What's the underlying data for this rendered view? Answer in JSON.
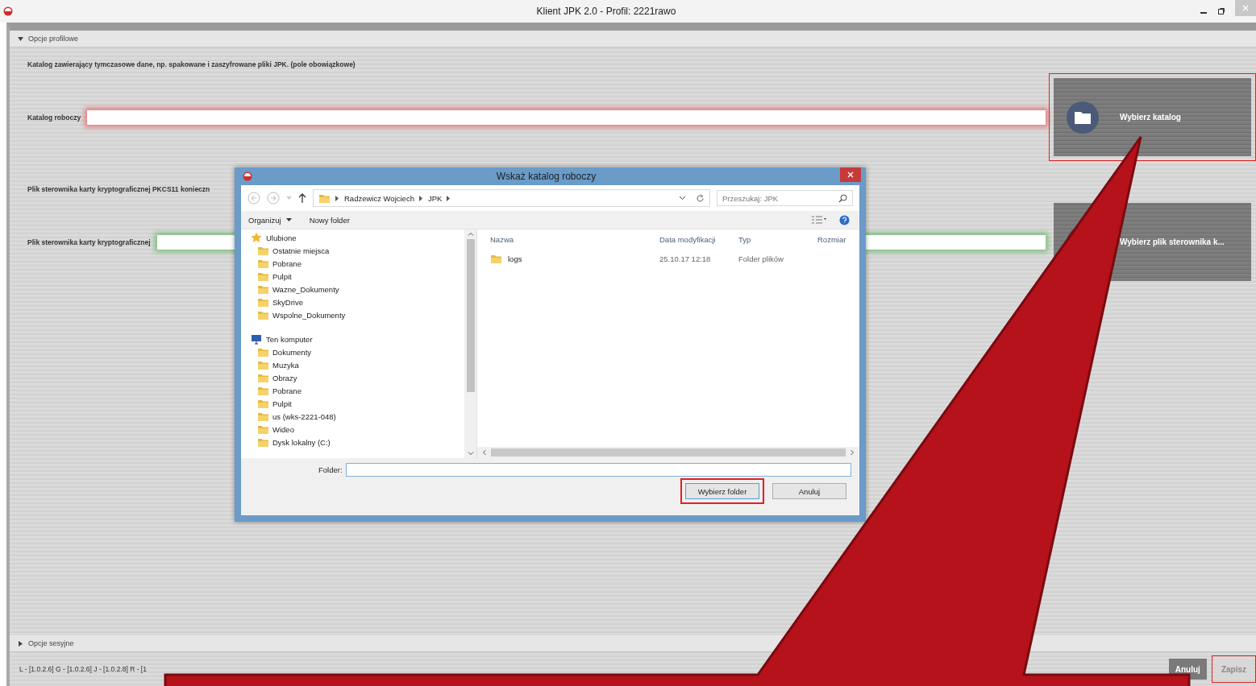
{
  "window": {
    "title": "Klient JPK 2.0 - Profil: 2221rawo"
  },
  "profile_section": {
    "label": "Opcje profilowe",
    "expanded": true
  },
  "description": "Katalog zawierający tymczasowe dane, np. spakowane i zaszyfrowane pliki JPK. (pole obowiązkowe)",
  "rows": [
    {
      "label": "Katalog roboczy",
      "valid": false,
      "button": {
        "label": "Wybierz katalog",
        "highlighted": true
      }
    },
    {
      "note": "Plik sterownika karty kryptograficznej PKCS11 konieczn",
      "label": "Plik sterownika karty kryptograficznej",
      "valid": true,
      "button": {
        "label": "Wybierz plik sterownika k...",
        "highlighted": false
      }
    }
  ],
  "dialog": {
    "title": "Wskaż katalog roboczy",
    "breadcrumb": [
      "Radzewicz Wojciech",
      "JPK"
    ],
    "search": {
      "placeholder": "Przeszukaj: JPK"
    },
    "toolbar": [
      {
        "label": "Organizuj",
        "dropdown": true
      },
      {
        "label": "Nowy folder",
        "dropdown": false
      }
    ],
    "nav": [
      {
        "label": "Ulubione",
        "children": [
          "Ostatnie miejsca",
          "Pobrane",
          "Pulpit",
          "Wazne_Dokumenty",
          "SkyDrive",
          "Wspolne_Dokumenty"
        ]
      },
      {
        "label": "Ten komputer",
        "children": [
          "Dokumenty",
          "Muzyka",
          "Obrazy",
          "Pobrane",
          "Pulpit",
          "us (wks-2221-048)",
          "Wideo",
          "Dysk lokalny (C:)"
        ]
      }
    ],
    "columns": [
      "Nazwa",
      "Data modyfikacji",
      "Typ",
      "Rozmiar"
    ],
    "files": [
      {
        "name": "logs",
        "date": "25.10.17 12:18",
        "type": "Folder plików"
      }
    ],
    "folder_label": "Folder:",
    "buttons": [
      {
        "label": "Wybierz folder",
        "highlighted": true
      },
      {
        "label": "Anuluj",
        "highlighted": false
      }
    ]
  },
  "session_section": {
    "label": "Opcje sesyjne",
    "expanded": false
  },
  "version": "L - [1.0.2.6] G - [1.0.2.6] J - [1.0.2.8] R - [1",
  "footer_buttons": [
    {
      "label": "Anuluj",
      "disabled": false,
      "highlighted": false
    },
    {
      "label": "Zapisz",
      "disabled": true,
      "highlighted": true
    }
  ]
}
